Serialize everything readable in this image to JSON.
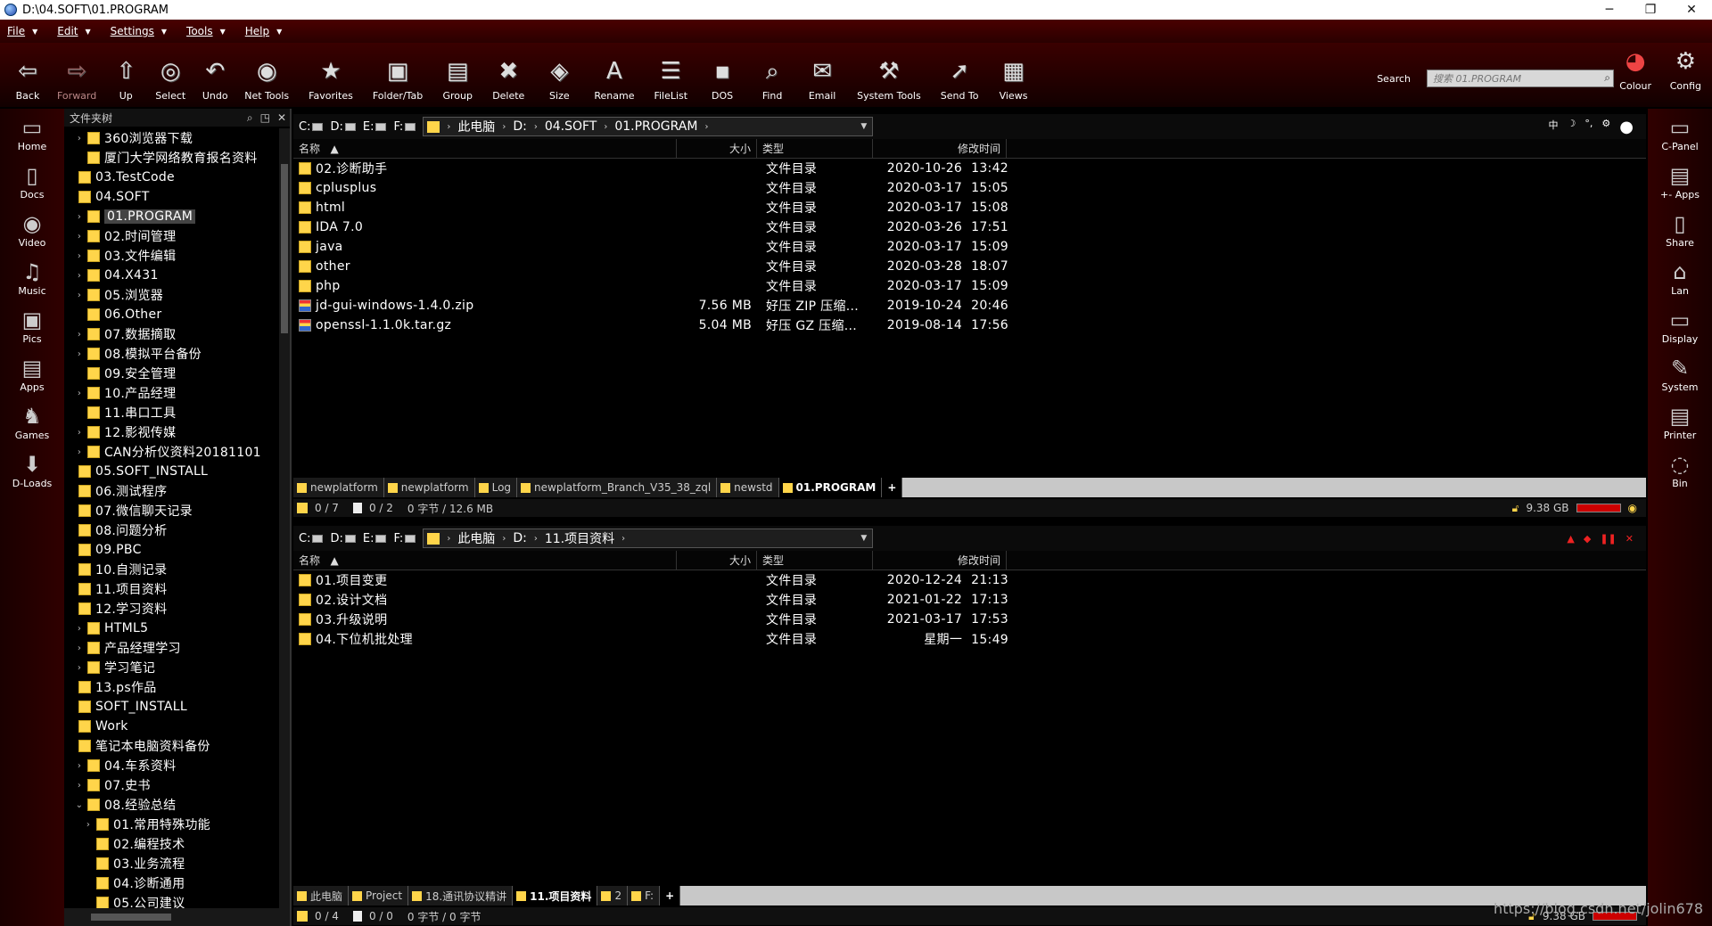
{
  "window": {
    "title": "D:\\04.SOFT\\01.PROGRAM"
  },
  "menu": [
    "File",
    "Edit",
    "Settings",
    "Tools",
    "Help"
  ],
  "toolbar": {
    "buttons": [
      {
        "label": "Back",
        "icon": "⇦"
      },
      {
        "label": "Forward",
        "icon": "⇨"
      },
      {
        "label": "Up",
        "icon": "⇧"
      },
      {
        "label": "Select",
        "icon": "◎"
      },
      {
        "label": "Undo",
        "icon": "↶"
      },
      {
        "label": "Net Tools",
        "icon": "◉"
      },
      {
        "label": "Favorites",
        "icon": "★"
      },
      {
        "label": "Folder/Tab",
        "icon": "▣"
      },
      {
        "label": "Group",
        "icon": "▤"
      },
      {
        "label": "Delete",
        "icon": "✖"
      },
      {
        "label": "Size",
        "icon": "◈"
      },
      {
        "label": "Rename",
        "icon": "A"
      },
      {
        "label": "FileList",
        "icon": "☰"
      },
      {
        "label": "DOS",
        "icon": "▪"
      },
      {
        "label": "Find",
        "icon": "⌕"
      },
      {
        "label": "Email",
        "icon": "✉"
      },
      {
        "label": "System Tools",
        "icon": "⚒"
      },
      {
        "label": "Send To",
        "icon": "➚"
      },
      {
        "label": "Views",
        "icon": "▦"
      }
    ],
    "search_label": "Search",
    "search_placeholder": "搜索 01.PROGRAM",
    "colour_label": "Colour",
    "config_label": "Config"
  },
  "left_sidebar": [
    {
      "label": "Home",
      "icon": "▭"
    },
    {
      "label": "Docs",
      "icon": "▯"
    },
    {
      "label": "Video",
      "icon": "◉"
    },
    {
      "label": "Music",
      "icon": "♫"
    },
    {
      "label": "Pics",
      "icon": "▣"
    },
    {
      "label": "Apps",
      "icon": "▤"
    },
    {
      "label": "Games",
      "icon": "♞"
    },
    {
      "label": "D-Loads",
      "icon": "⬇"
    }
  ],
  "right_sidebar": [
    {
      "label": "C-Panel",
      "icon": "▭"
    },
    {
      "label": "+- Apps",
      "icon": "▤"
    },
    {
      "label": "Share",
      "icon": "▯"
    },
    {
      "label": "Lan",
      "icon": "⌂"
    },
    {
      "label": "Display",
      "icon": "▭"
    },
    {
      "label": "System",
      "icon": "✎"
    },
    {
      "label": "Printer",
      "icon": "▤"
    },
    {
      "label": "Bin",
      "icon": "◌"
    }
  ],
  "tree": {
    "header": "文件夹树",
    "items": [
      {
        "label": "360浏览器下载",
        "depth": 1,
        "exp": "›"
      },
      {
        "label": "厦门大学网络教育报名资料",
        "depth": 1,
        "exp": ""
      },
      {
        "label": "03.TestCode",
        "depth": 0,
        "exp": ""
      },
      {
        "label": "04.SOFT",
        "depth": 0,
        "exp": ""
      },
      {
        "label": "01.PROGRAM",
        "depth": 1,
        "exp": "›",
        "selected": true
      },
      {
        "label": "02.时间管理",
        "depth": 1,
        "exp": "›"
      },
      {
        "label": "03.文件编辑",
        "depth": 1,
        "exp": "›"
      },
      {
        "label": "04.X431",
        "depth": 1,
        "exp": "›"
      },
      {
        "label": "05.浏览器",
        "depth": 1,
        "exp": "›"
      },
      {
        "label": "06.Other",
        "depth": 1,
        "exp": ""
      },
      {
        "label": "07.数据摘取",
        "depth": 1,
        "exp": "›"
      },
      {
        "label": "08.模拟平台备份",
        "depth": 1,
        "exp": "›"
      },
      {
        "label": "09.安全管理",
        "depth": 1,
        "exp": ""
      },
      {
        "label": "10.产品经理",
        "depth": 1,
        "exp": "›"
      },
      {
        "label": "11.串口工具",
        "depth": 1,
        "exp": ""
      },
      {
        "label": "12.影视传媒",
        "depth": 1,
        "exp": "›"
      },
      {
        "label": "CAN分析仪资料20181101",
        "depth": 1,
        "exp": "›"
      },
      {
        "label": "05.SOFT_INSTALL",
        "depth": 0,
        "exp": ""
      },
      {
        "label": "06.测试程序",
        "depth": 0,
        "exp": ""
      },
      {
        "label": "07.微信聊天记录",
        "depth": 0,
        "exp": ""
      },
      {
        "label": "08.问题分析",
        "depth": 0,
        "exp": ""
      },
      {
        "label": "09.PBC",
        "depth": 0,
        "exp": ""
      },
      {
        "label": "10.自测记录",
        "depth": 0,
        "exp": ""
      },
      {
        "label": "11.项目资料",
        "depth": 0,
        "exp": ""
      },
      {
        "label": "12.学习资料",
        "depth": 0,
        "exp": ""
      },
      {
        "label": "HTML5",
        "depth": 1,
        "exp": "›"
      },
      {
        "label": "产品经理学习",
        "depth": 1,
        "exp": "›"
      },
      {
        "label": "学习笔记",
        "depth": 1,
        "exp": "›"
      },
      {
        "label": "13.ps作品",
        "depth": 0,
        "exp": ""
      },
      {
        "label": "SOFT_INSTALL",
        "depth": 0,
        "exp": ""
      },
      {
        "label": "Work",
        "depth": 0,
        "exp": ""
      },
      {
        "label": "笔记本电脑资料备份",
        "depth": 0,
        "exp": ""
      },
      {
        "label": "04.车系资料",
        "depth": 1,
        "exp": "›"
      },
      {
        "label": "07.史书",
        "depth": 1,
        "exp": "›"
      },
      {
        "label": "08.经验总结",
        "depth": 1,
        "exp": "⌄"
      },
      {
        "label": "01.常用特殊功能",
        "depth": 2,
        "exp": "›"
      },
      {
        "label": "02.编程技术",
        "depth": 2,
        "exp": ""
      },
      {
        "label": "03.业务流程",
        "depth": 2,
        "exp": ""
      },
      {
        "label": "04.诊断通用",
        "depth": 2,
        "exp": ""
      },
      {
        "label": "05.公司建议",
        "depth": 2,
        "exp": ""
      }
    ]
  },
  "drives": [
    "C:",
    "D:",
    "E:",
    "F:"
  ],
  "columns": {
    "name": "名称",
    "size": "大小",
    "type": "类型",
    "modified": "修改时间"
  },
  "pane1": {
    "crumbs": [
      "此电脑",
      "D:",
      "04.SOFT",
      "01.PROGRAM"
    ],
    "files": [
      {
        "name": "02.诊断助手",
        "size": "",
        "type": "文件目录",
        "date": "2020-10-26",
        "time": "13:42",
        "icon": "folder"
      },
      {
        "name": "cplusplus",
        "size": "",
        "type": "文件目录",
        "date": "2020-03-17",
        "time": "15:05",
        "icon": "folder"
      },
      {
        "name": "html",
        "size": "",
        "type": "文件目录",
        "date": "2020-03-17",
        "time": "15:08",
        "icon": "folder"
      },
      {
        "name": "IDA 7.0",
        "size": "",
        "type": "文件目录",
        "date": "2020-03-26",
        "time": "17:51",
        "icon": "folder"
      },
      {
        "name": "java",
        "size": "",
        "type": "文件目录",
        "date": "2020-03-17",
        "time": "15:09",
        "icon": "folder"
      },
      {
        "name": "other",
        "size": "",
        "type": "文件目录",
        "date": "2020-03-28",
        "time": "18:07",
        "icon": "folder"
      },
      {
        "name": "php",
        "size": "",
        "type": "文件目录",
        "date": "2020-03-17",
        "time": "15:09",
        "icon": "folder"
      },
      {
        "name": "jd-gui-windows-1.4.0.zip",
        "size": "7.56 MB",
        "type": "好压 ZIP 压缩...",
        "date": "2019-10-24",
        "time": "20:46",
        "icon": "zip"
      },
      {
        "name": "openssl-1.1.0k.tar.gz",
        "size": "5.04 MB",
        "type": "好压 GZ 压缩...",
        "date": "2019-08-14",
        "time": "17:56",
        "icon": "zip"
      }
    ],
    "tabs": [
      "newplatform",
      "newplatform",
      "Log",
      "newplatform_Branch_V35_38_zql",
      "newstd",
      "01.PROGRAM"
    ],
    "active_tab": 5,
    "status": {
      "folders": "0 / 7",
      "files": "0 / 2",
      "bytes": "0 字节 / 12.6 MB",
      "free": "9.38 GB"
    }
  },
  "pane2": {
    "crumbs": [
      "此电脑",
      "D:",
      "11.项目资料"
    ],
    "files": [
      {
        "name": "01.项目变更",
        "size": "",
        "type": "文件目录",
        "date": "2020-12-24",
        "time": "21:13",
        "icon": "folder"
      },
      {
        "name": "02.设计文档",
        "size": "",
        "type": "文件目录",
        "date": "2021-01-22",
        "time": "17:13",
        "icon": "folder"
      },
      {
        "name": "03.升级说明",
        "size": "",
        "type": "文件目录",
        "date": "2021-03-17",
        "time": "17:53",
        "icon": "folder"
      },
      {
        "name": "04.下位机批处理",
        "size": "",
        "type": "文件目录",
        "date": "星期一",
        "time": "15:49",
        "icon": "folder"
      }
    ],
    "tabs": [
      "此电脑",
      "Project",
      "18.通讯协议精讲",
      "11.项目资料",
      "2",
      "F:"
    ],
    "active_tab": 3,
    "status": {
      "folders": "0 / 4",
      "files": "0 / 0",
      "bytes": "0 字节 / 0 字节",
      "free": "9.38 GB"
    }
  },
  "watermark": "https://blog.csdn.net/jolin678"
}
